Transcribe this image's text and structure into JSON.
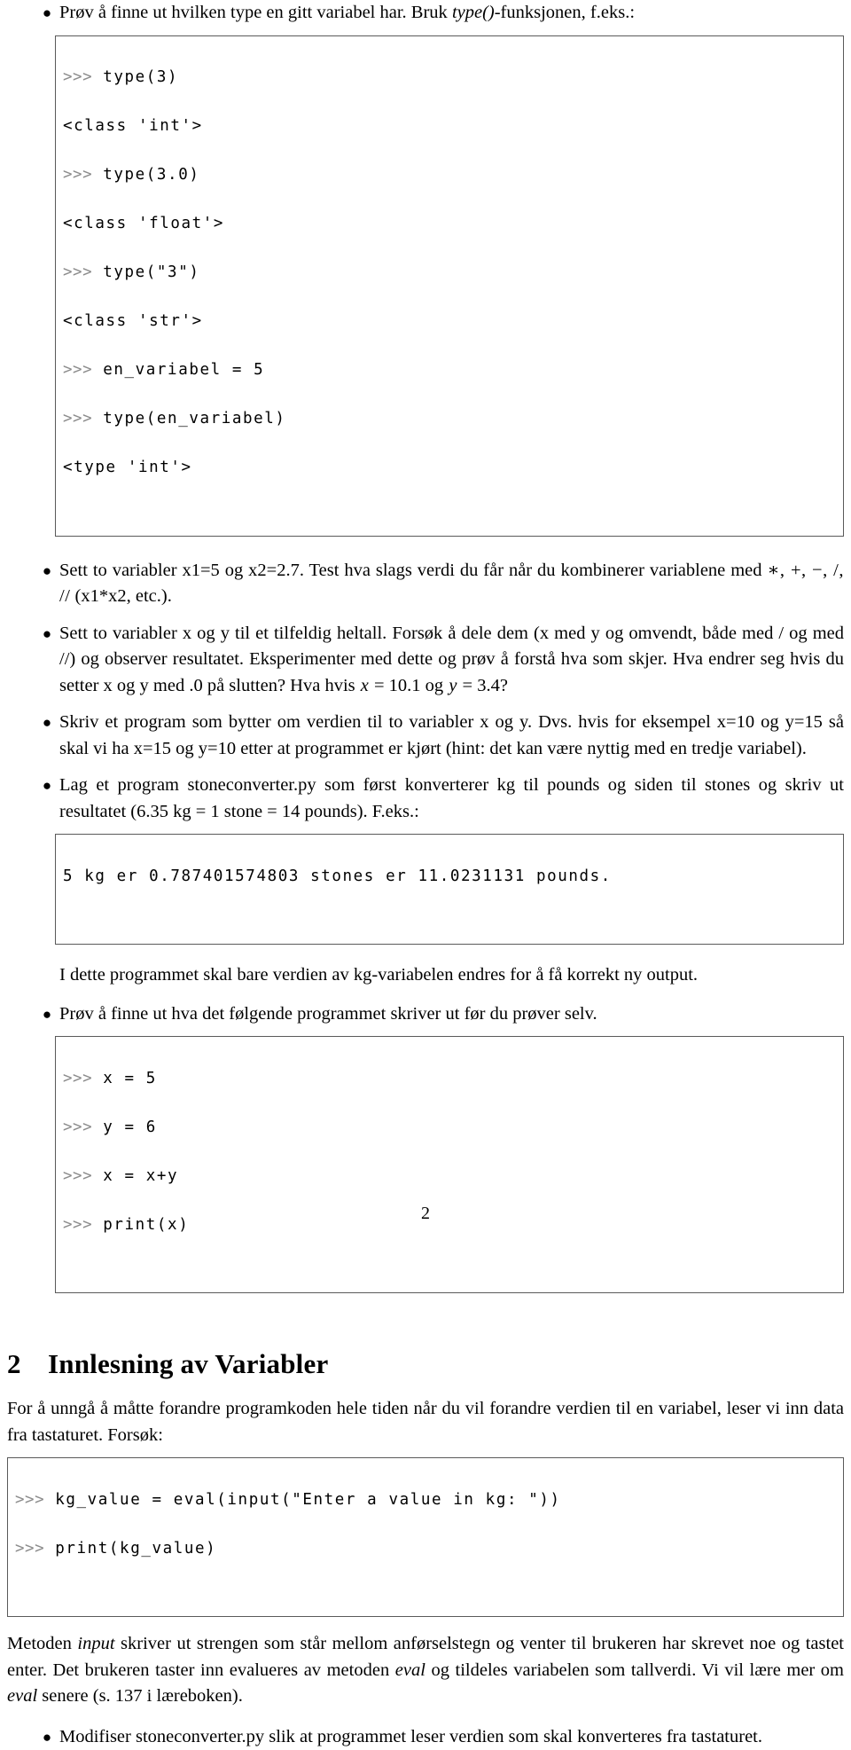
{
  "document": {
    "page_number": "2",
    "section": {
      "number": "2",
      "title": "Innlesning av Variabler"
    }
  },
  "bullets": {
    "b1": {
      "text_before_italic": "Prøv å finne ut hvilken type en gitt variabel har. Bruk ",
      "italic": "type()",
      "text_after_italic": "-funksjonen, f.eks.:"
    },
    "b2": {
      "line1": "Sett to variabler x1=5 og x2=2.7. Test hva slags verdi du får når du kombinerer variablene",
      "line2_prefix": "med ",
      "line2_ops": "∗, +, −, /, //",
      "line2_suffix": " (x1*x2, etc.)."
    },
    "b3": {
      "part1": "Sett to variabler x og y til et tilfeldig heltall. Forsøk å dele dem (x med y og omvendt, både med / og med //) og observer resultatet. Eksperimenter med dette og prøv å forstå hva som skjer. Hva endrer seg hvis du setter x og y med .0 på slutten? Hva hvis ",
      "var_x": "x",
      "eq1": " = 10.1 og ",
      "var_y": "y",
      "eq2": " = 3.4?"
    },
    "b4": {
      "text": "Skriv et program som bytter om verdien til to variabler x og y. Dvs. hvis for eksempel x=10 og y=15 så skal vi ha x=15 og y=10 etter at programmet er kjørt (hint: det kan være nyttig med en tredje variabel)."
    },
    "b5": {
      "text": "Lag et program stoneconverter.py som først konverterer kg til pounds og siden til stones og skriv ut resultatet (6.35 kg = 1 stone = 14 pounds). F.eks.:"
    },
    "b5_note": {
      "text": "I dette programmet skal bare verdien av kg-variabelen endres for å få korrekt ny output."
    },
    "b6": {
      "text": "Prøv å finne ut hva det følgende programmet skriver ut før du prøver selv."
    },
    "b7": {
      "text": "Modifiser stoneconverter.py slik at programmet leser verdien som skal konverteres fra tastaturet."
    }
  },
  "code_blocks": {
    "type_demo": {
      "lines": [
        {
          "prompt": ">>>",
          "code": " type(3)"
        },
        {
          "prompt": "",
          "code": "<class 'int'>"
        },
        {
          "prompt": ">>>",
          "code": " type(3.0)"
        },
        {
          "prompt": "",
          "code": "<class 'float'>"
        },
        {
          "prompt": ">>>",
          "code": " type(\"3\")"
        },
        {
          "prompt": "",
          "code": "<class 'str'>"
        },
        {
          "prompt": ">>>",
          "code": " en_variabel = 5"
        },
        {
          "prompt": ">>>",
          "code": " type(en_variabel)"
        },
        {
          "prompt": "",
          "code": "<type 'int'>"
        }
      ]
    },
    "stone_output": {
      "lines": [
        {
          "prompt": "",
          "code": "5 kg er 0.787401574803 stones er 11.0231131 pounds."
        }
      ]
    },
    "swap_demo": {
      "lines": [
        {
          "prompt": ">>>",
          "code": " x = 5"
        },
        {
          "prompt": ">>>",
          "code": " y = 6"
        },
        {
          "prompt": ">>>",
          "code": " x = x+y"
        },
        {
          "prompt": ">>>",
          "code": " print(x)"
        }
      ]
    },
    "input_demo": {
      "lines": [
        {
          "prompt": ">>>",
          "code": " kg_value = eval(input(\"Enter a value in kg: \"))"
        },
        {
          "prompt": ">>>",
          "code": " print(kg_value)"
        }
      ]
    }
  },
  "section_body": {
    "intro": "For å unngå å måtte forandre programkoden hele tiden når du vil forandre verdien til en variabel, leser vi inn data fra tastaturet. Forsøk:",
    "explain_p1": "Metoden ",
    "explain_it1": "input",
    "explain_p2": " skriver ut strengen som står mellom anførselstegn og venter til brukeren har skrevet noe og tastet enter. Det brukeren taster inn evalueres av metoden ",
    "explain_it2": "eval",
    "explain_p3": " og tildeles variabelen som tallverdi. Vi vil lære mer om ",
    "explain_it3": "eval",
    "explain_p4": " senere (s. 137 i læreboken)."
  }
}
